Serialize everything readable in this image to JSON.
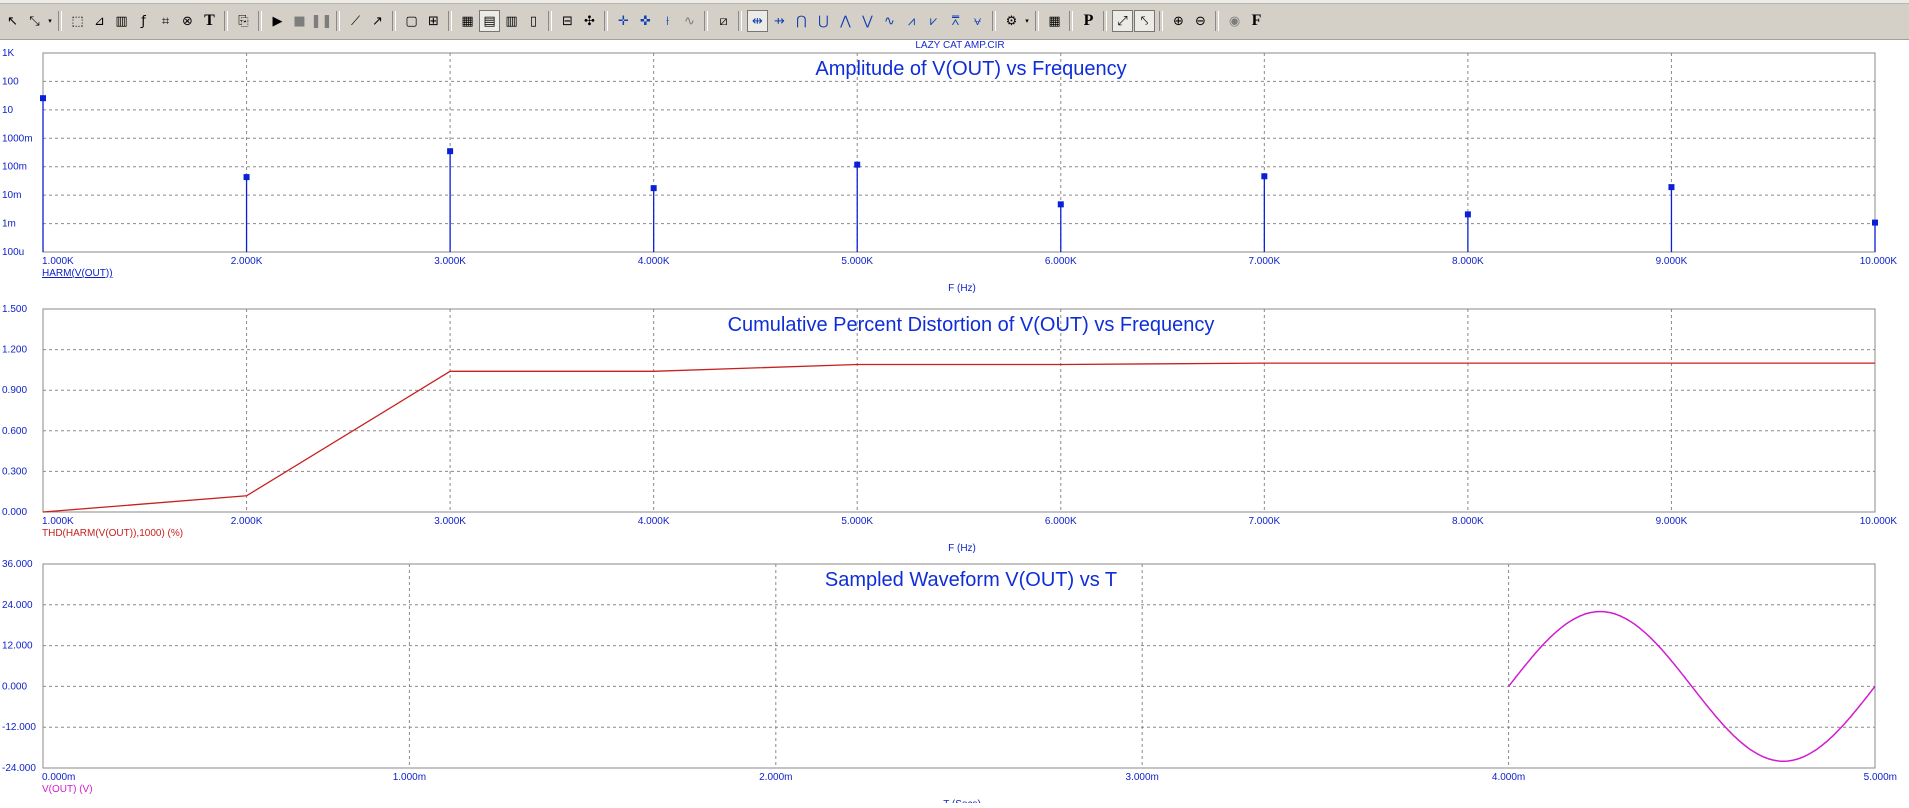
{
  "file_title": "LAZY CAT AMP.CIR",
  "colors": {
    "axis_text": "#0b1fc8",
    "title": "#0f2ed8",
    "harmonics": "#0a20d6",
    "thd": "#c8201e",
    "waveform": "#d21bd2",
    "grid": "#8a8a8a",
    "frame": "#8a8a8a"
  },
  "toolbar": {
    "icons": [
      {
        "name": "select-arrow-icon",
        "glyph": "↖",
        "style": "",
        "interactable": true
      },
      {
        "name": "scale-icon",
        "glyph": "⤡",
        "style": "",
        "interactable": true
      },
      {
        "name": "scale-dropdown-icon",
        "glyph": "▾",
        "style": "dd",
        "interactable": true
      },
      {
        "name": "sep",
        "glyph": "",
        "style": "sep"
      },
      {
        "name": "graph-select-icon",
        "glyph": "⬚",
        "style": "",
        "interactable": true
      },
      {
        "name": "graph-area-icon",
        "glyph": "⊿",
        "style": "",
        "interactable": true
      },
      {
        "name": "bar-graph-icon",
        "glyph": "▥",
        "style": "",
        "interactable": true
      },
      {
        "name": "trace-icon",
        "glyph": "ƒ",
        "style": "",
        "interactable": true
      },
      {
        "name": "cursor-trace-icon",
        "glyph": "⌗",
        "style": "",
        "interactable": true
      },
      {
        "name": "delete-trace-icon",
        "glyph": "⊗",
        "style": "",
        "interactable": true
      },
      {
        "name": "text-tool-icon",
        "glyph": "T",
        "style": "bold",
        "interactable": true
      },
      {
        "name": "sep",
        "glyph": "",
        "style": "sep"
      },
      {
        "name": "copy-plot-icon",
        "glyph": "⎘",
        "style": "",
        "interactable": true
      },
      {
        "name": "sep",
        "glyph": "",
        "style": "sep"
      },
      {
        "name": "run-icon",
        "glyph": "▶",
        "style": "",
        "interactable": true
      },
      {
        "name": "stop-icon",
        "glyph": "■",
        "style": "gray",
        "interactable": true
      },
      {
        "name": "pause-icon",
        "glyph": "❚❚",
        "style": "gray",
        "interactable": true
      },
      {
        "name": "sep",
        "glyph": "",
        "style": "sep"
      },
      {
        "name": "line-icon",
        "glyph": "⟋",
        "style": "",
        "interactable": true
      },
      {
        "name": "arrow-line-icon",
        "glyph": "↗",
        "style": "",
        "interactable": true
      },
      {
        "name": "sep",
        "glyph": "",
        "style": "sep"
      },
      {
        "name": "frame-icon",
        "glyph": "▢",
        "style": "",
        "interactable": true
      },
      {
        "name": "grid-icon",
        "glyph": "⊞",
        "style": "",
        "interactable": true
      },
      {
        "name": "sep",
        "glyph": "",
        "style": "sep"
      },
      {
        "name": "minor-grid-icon",
        "glyph": "▦",
        "style": "",
        "interactable": true
      },
      {
        "name": "hgrid-icon",
        "glyph": "▤",
        "style": "pressed",
        "interactable": true
      },
      {
        "name": "vgrid-icon",
        "glyph": "▥",
        "style": "",
        "interactable": true
      },
      {
        "name": "no-grid-icon",
        "glyph": "▯",
        "style": "",
        "interactable": true
      },
      {
        "name": "sep",
        "glyph": "",
        "style": "sep"
      },
      {
        "name": "tokens-icon",
        "glyph": "⊟",
        "style": "",
        "interactable": true
      },
      {
        "name": "data-points-icon",
        "glyph": "✣",
        "style": "",
        "interactable": true
      },
      {
        "name": "sep",
        "glyph": "",
        "style": "sep"
      },
      {
        "name": "peak-cursor-icon",
        "glyph": "✛",
        "style": "blue",
        "interactable": true
      },
      {
        "name": "valley-cursor-icon",
        "glyph": "✜",
        "style": "blue",
        "interactable": true
      },
      {
        "name": "slope-cursor-icon",
        "glyph": "⟊",
        "style": "blue",
        "interactable": true
      },
      {
        "name": "sample-icon",
        "glyph": "∿",
        "style": "gray",
        "interactable": true
      },
      {
        "name": "sep",
        "glyph": "",
        "style": "sep"
      },
      {
        "name": "cursor-mode-icon",
        "glyph": "⧄",
        "style": "",
        "interactable": true
      },
      {
        "name": "sep",
        "glyph": "",
        "style": "sep"
      },
      {
        "name": "left-cursor-icon",
        "glyph": "⇹",
        "style": "pressed blue",
        "interactable": true
      },
      {
        "name": "right-cursor-icon",
        "glyph": "⇸",
        "style": "blue",
        "interactable": true
      },
      {
        "name": "peak-icon",
        "glyph": "⋂",
        "style": "blue",
        "interactable": true
      },
      {
        "name": "valley-icon",
        "glyph": "⋃",
        "style": "blue",
        "interactable": true
      },
      {
        "name": "high-icon",
        "glyph": "⋀",
        "style": "blue",
        "interactable": true
      },
      {
        "name": "low-icon",
        "glyph": "⋁",
        "style": "blue",
        "interactable": true
      },
      {
        "name": "inflection-icon",
        "glyph": "∿",
        "style": "blue",
        "interactable": true
      },
      {
        "name": "global-high-icon",
        "glyph": "⩘",
        "style": "blue",
        "interactable": true
      },
      {
        "name": "global-low-icon",
        "glyph": "⩗",
        "style": "blue",
        "interactable": true
      },
      {
        "name": "top-icon",
        "glyph": "⩞",
        "style": "blue",
        "interactable": true
      },
      {
        "name": "bottom-icon",
        "glyph": "⩝",
        "style": "blue",
        "interactable": true
      },
      {
        "name": "sep",
        "glyph": "",
        "style": "sep"
      },
      {
        "name": "probe-icon",
        "glyph": "⚙",
        "style": "",
        "interactable": true
      },
      {
        "name": "probe-dropdown-icon",
        "glyph": "▾",
        "style": "dd",
        "interactable": true
      },
      {
        "name": "sep",
        "glyph": "",
        "style": "sep"
      },
      {
        "name": "table-icon",
        "glyph": "▦",
        "style": "",
        "interactable": true
      },
      {
        "name": "sep",
        "glyph": "",
        "style": "sep"
      },
      {
        "name": "p-label-icon",
        "glyph": "P",
        "style": "bold",
        "interactable": true
      },
      {
        "name": "sep",
        "glyph": "",
        "style": "sep"
      },
      {
        "name": "axis-autoscale-icon",
        "glyph": "⤢",
        "style": "pressed",
        "interactable": true
      },
      {
        "name": "axis-scale-icon",
        "glyph": "⤣",
        "style": "pressed",
        "interactable": true
      },
      {
        "name": "sep",
        "glyph": "",
        "style": "sep"
      },
      {
        "name": "zoom-in-icon",
        "glyph": "⊕",
        "style": "",
        "interactable": true
      },
      {
        "name": "zoom-out-icon",
        "glyph": "⊖",
        "style": "",
        "interactable": true
      },
      {
        "name": "sep",
        "glyph": "",
        "style": "sep"
      },
      {
        "name": "settings-disc-icon",
        "glyph": "◉",
        "style": "gray",
        "interactable": true
      },
      {
        "name": "font-icon",
        "glyph": "F",
        "style": "bold",
        "interactable": true
      }
    ]
  },
  "plots": [
    {
      "id": "harmonics",
      "title": "Amplitude of V(OUT) vs Frequency",
      "y_ticks": [
        "1K",
        "100",
        "10",
        "1000m",
        "100m",
        "10m",
        "1m",
        "100u"
      ],
      "x_ticks": [
        "1.000K",
        "2.000K",
        "3.000K",
        "4.000K",
        "5.000K",
        "6.000K",
        "7.000K",
        "8.000K",
        "9.000K",
        "10.000K"
      ],
      "x_title": "F (Hz)",
      "trace_label": "HARM(V(OUT))"
    },
    {
      "id": "thd",
      "title": "Cumulative Percent Distortion of V(OUT) vs Frequency",
      "y_ticks": [
        "1.500",
        "1.200",
        "0.900",
        "0.600",
        "0.300",
        "0.000"
      ],
      "x_ticks": [
        "1.000K",
        "2.000K",
        "3.000K",
        "4.000K",
        "5.000K",
        "6.000K",
        "7.000K",
        "8.000K",
        "9.000K",
        "10.000K"
      ],
      "x_title": "F (Hz)",
      "trace_label": "THD(HARM(V(OUT)),1000) (%)"
    },
    {
      "id": "waveform",
      "title": "Sampled Waveform  V(OUT) vs T",
      "y_ticks": [
        "36.000",
        "24.000",
        "12.000",
        "0.000",
        "-12.000",
        "-24.000"
      ],
      "x_ticks": [
        "0.000m",
        "1.000m",
        "2.000m",
        "3.000m",
        "4.000m",
        "5.000m"
      ],
      "x_title": "T (Secs)",
      "trace_label": "V(OUT) (V)"
    }
  ],
  "chart_data": [
    {
      "type": "bar",
      "title": "Amplitude of V(OUT) vs Frequency",
      "xlabel": "F (Hz)",
      "ylabel": "",
      "log_y": true,
      "ylim": [
        5e-05,
        1000
      ],
      "xlim": [
        1000,
        10000
      ],
      "grid": true,
      "series": [
        {
          "name": "HARM(V(OUT))",
          "x": [
            1000,
            2000,
            3000,
            4000,
            5000,
            6000,
            7000,
            8000,
            9000,
            10000
          ],
          "values": [
            22,
            0.028,
            0.25,
            0.011,
            0.08,
            0.0028,
            0.03,
            0.0012,
            0.012,
            0.0006
          ]
        }
      ]
    },
    {
      "type": "line",
      "title": "Cumulative Percent Distortion of V(OUT) vs Frequency",
      "xlabel": "F (Hz)",
      "ylabel": "",
      "ylim": [
        0,
        1.5
      ],
      "xlim": [
        1000,
        10000
      ],
      "grid": true,
      "series": [
        {
          "name": "THD(HARM(V(OUT)),1000) (%)",
          "x": [
            1000,
            2000,
            3000,
            4000,
            5000,
            6000,
            7000,
            8000,
            9000,
            10000
          ],
          "values": [
            0.0,
            0.12,
            1.04,
            1.04,
            1.09,
            1.09,
            1.1,
            1.1,
            1.1,
            1.1
          ]
        }
      ]
    },
    {
      "type": "line",
      "title": "Sampled Waveform  V(OUT) vs T",
      "xlabel": "T (Secs)",
      "ylabel": "",
      "ylim": [
        -24,
        36
      ],
      "xlim": [
        0,
        0.005
      ],
      "grid": true,
      "series": [
        {
          "name": "V(OUT) (V)",
          "x": [
            0.004,
            0.0041,
            0.0042,
            0.00425,
            0.0043,
            0.0044,
            0.0045,
            0.0046,
            0.0047,
            0.00475,
            0.0048,
            0.0049,
            0.005
          ],
          "values": [
            0,
            13,
            21,
            22,
            21,
            13,
            0,
            -13,
            -21,
            -22,
            -21,
            -13,
            0
          ]
        }
      ]
    }
  ]
}
